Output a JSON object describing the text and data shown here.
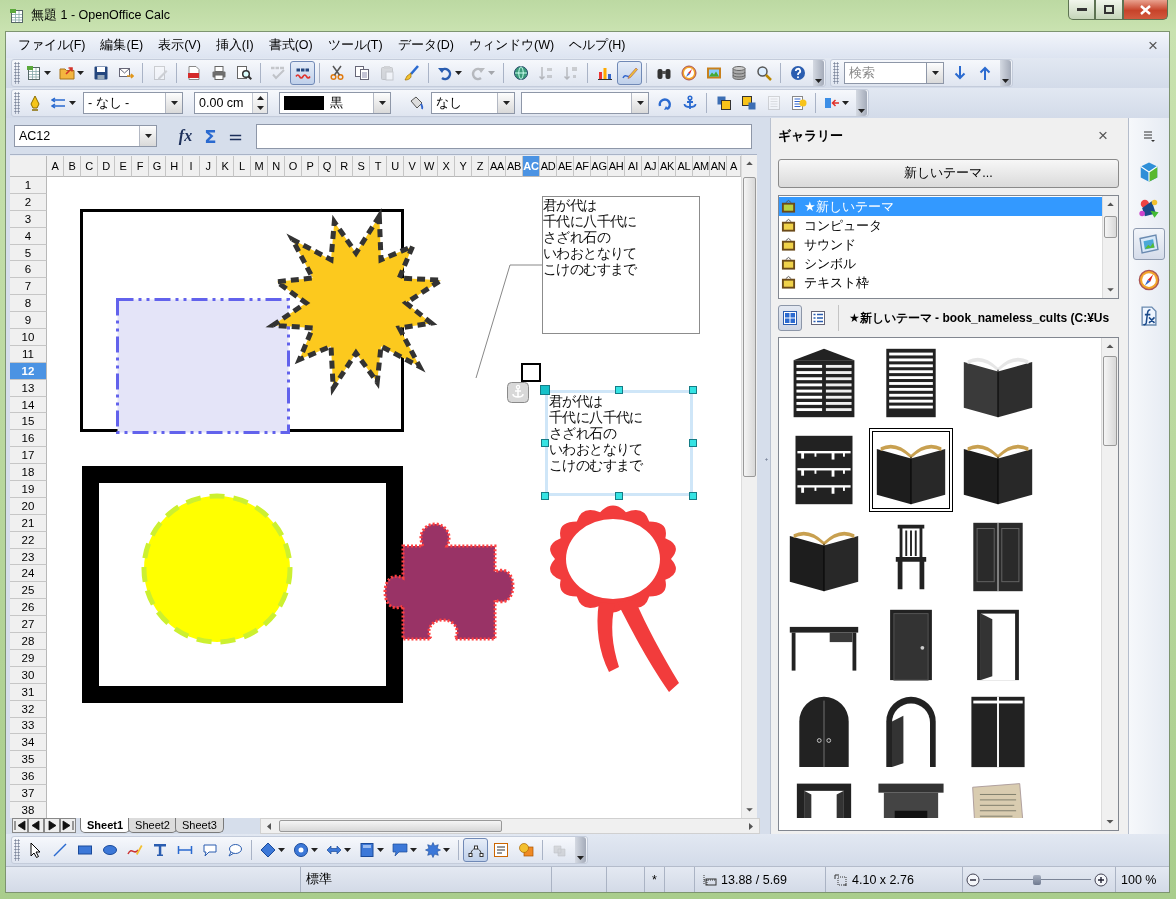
{
  "window": {
    "title": "無題 1 - OpenOffice Calc"
  },
  "menu_bar": {
    "items": [
      "ファイル(F)",
      "編集(E)",
      "表示(V)",
      "挿入(I)",
      "書式(O)",
      "ツール(T)",
      "データ(D)",
      "ウィンドウ(W)",
      "ヘルプ(H)"
    ],
    "close": "×"
  },
  "standard_toolbar": {
    "groups": [
      [
        {
          "kind": "new",
          "on": false,
          "disabled": false,
          "dropdown": true
        },
        {
          "kind": "open",
          "on": false,
          "disabled": false,
          "dropdown": true
        },
        {
          "kind": "save",
          "on": false,
          "disabled": false
        },
        {
          "kind": "email",
          "on": false,
          "disabled": false
        }
      ],
      [
        {
          "kind": "edit",
          "on": false,
          "disabled": true
        }
      ],
      [
        {
          "kind": "pdf",
          "on": false,
          "disabled": false
        },
        {
          "kind": "print",
          "on": false,
          "disabled": false
        },
        {
          "kind": "preview",
          "on": false,
          "disabled": false
        }
      ],
      [
        {
          "kind": "spellcheck",
          "on": false,
          "disabled": true
        },
        {
          "kind": "autospell",
          "on": true,
          "disabled": false
        }
      ],
      [
        {
          "kind": "cut",
          "on": false,
          "disabled": false
        },
        {
          "kind": "copy",
          "on": false,
          "disabled": false
        },
        {
          "kind": "paste",
          "on": false,
          "disabled": true
        },
        {
          "kind": "brush",
          "on": false,
          "disabled": false
        }
      ],
      [
        {
          "kind": "undo",
          "on": false,
          "disabled": false,
          "dropdown": true
        },
        {
          "kind": "redo",
          "on": false,
          "disabled": true,
          "dropdown": true
        }
      ],
      [
        {
          "kind": "hyperlink",
          "on": false,
          "disabled": false
        },
        {
          "kind": "sortasc",
          "on": false,
          "disabled": true
        },
        {
          "kind": "sortdesc",
          "on": false,
          "disabled": true
        }
      ],
      [
        {
          "kind": "chart",
          "on": false,
          "disabled": false
        },
        {
          "kind": "draw",
          "on": true,
          "disabled": false
        }
      ],
      [
        {
          "kind": "find",
          "on": false,
          "disabled": false
        },
        {
          "kind": "navigator",
          "on": false,
          "disabled": false
        },
        {
          "kind": "gallery",
          "on": false,
          "disabled": false
        },
        {
          "kind": "database",
          "on": false,
          "disabled": false
        },
        {
          "kind": "zoom",
          "on": false,
          "disabled": false
        }
      ],
      [
        {
          "kind": "help",
          "on": false,
          "disabled": false
        }
      ]
    ]
  },
  "find_toolbar": {
    "search": {
      "placeholder": "検索"
    },
    "tools": [
      {
        "kind": "next",
        "on": false,
        "disabled": false
      },
      {
        "kind": "previous",
        "on": false,
        "disabled": false
      }
    ]
  },
  "object_toolbar": {
    "groups": [
      [
        {
          "kind": "linestyle",
          "on": false,
          "disabled": false
        },
        {
          "kind": "arrowstyle",
          "on": false,
          "disabled": false,
          "dropdown": true
        },
        {
          "kind": "select",
          "value": "- なし -"
        },
        {
          "kind": "spinner",
          "value": "0.00 cm"
        },
        {
          "kind": "colorselect",
          "value": "黒",
          "color": "#000000"
        },
        {
          "kind": "area",
          "on": false,
          "disabled": false
        },
        {
          "kind": "select",
          "value": "なし"
        },
        {
          "kind": "select"
        },
        {
          "kind": "rotate",
          "on": false,
          "disabled": false
        },
        {
          "kind": "anchor",
          "on": false,
          "disabled": false
        }
      ],
      [
        {
          "kind": "front",
          "on": false,
          "disabled": false
        },
        {
          "kind": "back",
          "on": false,
          "disabled": false
        },
        {
          "kind": "wrapoff",
          "on": false,
          "disabled": true
        },
        {
          "kind": "wrap",
          "on": false,
          "disabled": false
        }
      ],
      [
        {
          "kind": "align",
          "on": false,
          "disabled": false,
          "dropdown": true
        }
      ]
    ]
  },
  "formula_bar": {
    "name_box": "AC12",
    "buttons": [
      "fx",
      "Σ",
      "="
    ]
  },
  "sheet": {
    "columns": [
      {
        "label": "A",
        "selected": false
      },
      {
        "label": "B",
        "selected": false
      },
      {
        "label": "C",
        "selected": false
      },
      {
        "label": "D",
        "selected": false
      },
      {
        "label": "E",
        "selected": false
      },
      {
        "label": "F",
        "selected": false
      },
      {
        "label": "G",
        "selected": false
      },
      {
        "label": "H",
        "selected": false
      },
      {
        "label": "I",
        "selected": false
      },
      {
        "label": "J",
        "selected": false
      },
      {
        "label": "K",
        "selected": false
      },
      {
        "label": "L",
        "selected": false
      },
      {
        "label": "M",
        "selected": false
      },
      {
        "label": "N",
        "selected": false
      },
      {
        "label": "O",
        "selected": false
      },
      {
        "label": "P",
        "selected": false
      },
      {
        "label": "Q",
        "selected": false
      },
      {
        "label": "R",
        "selected": false
      },
      {
        "label": "S",
        "selected": false
      },
      {
        "label": "T",
        "selected": false
      },
      {
        "label": "U",
        "selected": false
      },
      {
        "label": "V",
        "selected": false
      },
      {
        "label": "W",
        "selected": false
      },
      {
        "label": "X",
        "selected": false
      },
      {
        "label": "Y",
        "selected": false
      },
      {
        "label": "Z",
        "selected": false
      },
      {
        "label": "AA",
        "selected": false
      },
      {
        "label": "AB",
        "selected": false
      },
      {
        "label": "AC",
        "selected": true
      },
      {
        "label": "AD",
        "selected": false
      },
      {
        "label": "AE",
        "selected": false
      },
      {
        "label": "AF",
        "selected": false
      },
      {
        "label": "AG",
        "selected": false
      },
      {
        "label": "AH",
        "selected": false
      },
      {
        "label": "AI",
        "selected": false
      },
      {
        "label": "AJ",
        "selected": false
      },
      {
        "label": "AK",
        "selected": false
      },
      {
        "label": "AL",
        "selected": false
      },
      {
        "label": "AM",
        "selected": false
      },
      {
        "label": "AN",
        "selected": false
      },
      {
        "label": "A",
        "selected": false
      }
    ],
    "rows": [
      {
        "label": "1",
        "selected": false
      },
      {
        "label": "2",
        "selected": false
      },
      {
        "label": "3",
        "selected": false
      },
      {
        "label": "4",
        "selected": false
      },
      {
        "label": "5",
        "selected": false
      },
      {
        "label": "6",
        "selected": false
      },
      {
        "label": "7",
        "selected": false
      },
      {
        "label": "8",
        "selected": false
      },
      {
        "label": "9",
        "selected": false
      },
      {
        "label": "10",
        "selected": false
      },
      {
        "label": "11",
        "selected": false
      },
      {
        "label": "12",
        "selected": true
      },
      {
        "label": "13",
        "selected": false
      },
      {
        "label": "14",
        "selected": false
      },
      {
        "label": "15",
        "selected": false
      },
      {
        "label": "16",
        "selected": false
      },
      {
        "label": "17",
        "selected": false
      },
      {
        "label": "18",
        "selected": false
      },
      {
        "label": "19",
        "selected": false
      },
      {
        "label": "20",
        "selected": false
      },
      {
        "label": "21",
        "selected": false
      },
      {
        "label": "22",
        "selected": false
      },
      {
        "label": "23",
        "selected": false
      },
      {
        "label": "24",
        "selected": false
      },
      {
        "label": "25",
        "selected": false
      },
      {
        "label": "26",
        "selected": false
      },
      {
        "label": "27",
        "selected": false
      },
      {
        "label": "28",
        "selected": false
      },
      {
        "label": "29",
        "selected": false
      },
      {
        "label": "30",
        "selected": false
      },
      {
        "label": "31",
        "selected": false
      },
      {
        "label": "32",
        "selected": false
      },
      {
        "label": "33",
        "selected": false
      },
      {
        "label": "34",
        "selected": false
      },
      {
        "label": "35",
        "selected": false
      },
      {
        "label": "36",
        "selected": false
      },
      {
        "label": "37",
        "selected": false
      },
      {
        "label": "38",
        "selected": false
      }
    ]
  },
  "canvas": {
    "text_boxes": [
      {
        "kind": "callout",
        "lines": [
          "君が代は",
          "千代に八千代に",
          "さざれ石の",
          "いわおとなりて",
          "こけのむすまで"
        ],
        "selected": false
      },
      {
        "kind": "plain",
        "lines": [
          "君が代は",
          "千代に八千代に",
          "さざれ石の",
          "いわおとなりて",
          "こけのむすまで"
        ],
        "selected": true
      }
    ]
  },
  "sheet_tabs": [
    {
      "label": "Sheet1",
      "selected": true
    },
    {
      "label": "Sheet2",
      "selected": false
    },
    {
      "label": "Sheet3",
      "selected": false
    }
  ],
  "gallery": {
    "title": "ギャラリー",
    "close": "×",
    "new_theme": "新しいテーマ...",
    "themes": [
      {
        "label": "★新しいテーマ",
        "selected": true
      },
      {
        "label": "コンピュータ",
        "selected": false
      },
      {
        "label": "サウンド",
        "selected": false
      },
      {
        "label": "シンボル",
        "selected": false
      },
      {
        "label": "テキスト枠",
        "selected": false
      }
    ],
    "view_modes": [
      {
        "kind": "icons",
        "selected": true
      },
      {
        "kind": "details",
        "selected": false
      }
    ],
    "caption": "★新しいテーマ - book_nameless_cults (C:¥Us",
    "items": [
      {
        "kind": "tower",
        "selected": false
      },
      {
        "kind": "building",
        "selected": false
      },
      {
        "kind": "book",
        "selected": false
      },
      {
        "kind": "bookcase",
        "selected": false
      },
      {
        "kind": "tome",
        "selected": true
      },
      {
        "kind": "tome",
        "selected": false
      },
      {
        "kind": "tome",
        "selected": false
      },
      {
        "kind": "chair",
        "selected": false
      },
      {
        "kind": "cabinet",
        "selected": false
      },
      {
        "kind": "desk",
        "selected": false
      },
      {
        "kind": "door",
        "selected": false
      },
      {
        "kind": "opendoor",
        "selected": false
      },
      {
        "kind": "archdoor",
        "selected": false
      },
      {
        "kind": "archopen",
        "selected": false
      },
      {
        "kind": "wardrobe",
        "selected": false
      },
      {
        "kind": "doorway",
        "selected": false
      },
      {
        "kind": "fireplace",
        "selected": false
      },
      {
        "kind": "paper",
        "selected": false
      }
    ]
  },
  "sidebar": {
    "tabs": [
      {
        "kind": "properties",
        "selected": false
      },
      {
        "kind": "styles",
        "selected": false
      },
      {
        "kind": "gallery",
        "selected": true
      },
      {
        "kind": "navigator",
        "selected": false
      },
      {
        "kind": "functions",
        "selected": false
      }
    ]
  },
  "drawing_toolbar": {
    "groups": [
      [
        {
          "kind": "pointer",
          "on": false,
          "disabled": false
        },
        {
          "kind": "line",
          "on": false,
          "disabled": false
        },
        {
          "kind": "rect",
          "on": false,
          "disabled": false
        },
        {
          "kind": "ellipse",
          "on": false,
          "disabled": false
        },
        {
          "kind": "freeform",
          "on": false,
          "disabled": false
        },
        {
          "kind": "text",
          "on": false,
          "disabled": false
        },
        {
          "kind": "dimension",
          "on": false,
          "disabled": false
        },
        {
          "kind": "callout",
          "on": false,
          "disabled": false
        },
        {
          "kind": "legend",
          "on": false,
          "disabled": false
        }
      ],
      [
        {
          "kind": "basic",
          "on": false,
          "disabled": false,
          "dropdown": true
        },
        {
          "kind": "symbol",
          "on": false,
          "disabled": false,
          "dropdown": true
        },
        {
          "kind": "blockarrow",
          "on": false,
          "disabled": false,
          "dropdown": true
        },
        {
          "kind": "flowchart",
          "on": false,
          "disabled": false,
          "dropdown": true
        },
        {
          "kind": "callouts",
          "on": false,
          "disabled": false,
          "dropdown": true
        },
        {
          "kind": "stars",
          "on": false,
          "disabled": false,
          "dropdown": true
        }
      ],
      [
        {
          "kind": "points",
          "on": true,
          "disabled": false
        },
        {
          "kind": "fontwork",
          "on": false,
          "disabled": false
        },
        {
          "kind": "shapes",
          "on": false,
          "disabled": false
        }
      ],
      [
        {
          "kind": "extrusion",
          "on": false,
          "disabled": true
        }
      ]
    ]
  },
  "status_bar": {
    "style": "標準",
    "modified": "*",
    "position": "13.88 / 5.69",
    "size": "4.10 x 2.76",
    "zoom": {
      "level": 0.5,
      "reading": "100 %"
    }
  }
}
